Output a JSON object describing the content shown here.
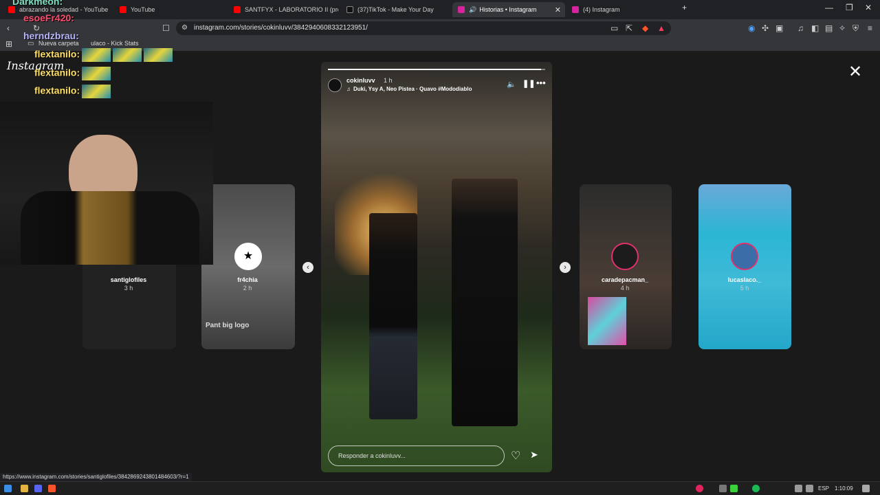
{
  "browser": {
    "tabs": [
      {
        "label": "abrazando la soledad - YouTube",
        "color": "#ff0000"
      },
      {
        "label": "YouTube",
        "color": "#ff0000"
      },
      {
        "label": "SANTFYX - LABORATORIO II (prod.qu",
        "color": "#ff0000"
      },
      {
        "label": "(37)TikTok - Make Your Day",
        "color": "#111111"
      },
      {
        "label": "Historias • Instagram",
        "color": "#d6249f"
      },
      {
        "label": "(4) Instagram",
        "color": "#d6249f"
      }
    ],
    "url": "instagram.com/stories/cokinluvv/3842940608332123951/",
    "bookmarks": [
      "Nueva carpeta",
      "ulaco - Kick Stats"
    ],
    "status_url": "https://www.instagram.com/stories/santiglofiles/3842869243801484603/?r=1"
  },
  "overlay": {
    "chat": [
      {
        "user": "Darkmeon:",
        "color": "#7ee0c0"
      },
      {
        "user": "esoeFr420:",
        "color": "#ff4b6e"
      },
      {
        "user": "herndzbrau:",
        "color": "#b7b7ff"
      },
      {
        "user": "flextanilo:",
        "color": "#ffe066"
      },
      {
        "user": "flextanilo:",
        "color": "#ffe066"
      },
      {
        "user": "flextanilo:",
        "color": "#ffe066"
      }
    ]
  },
  "app": {
    "logo": "Instagram",
    "close_icon": "close-icon"
  },
  "stories_left": [
    {
      "username": "santiglofiles",
      "time": "3 h"
    },
    {
      "username": "fr4chia",
      "time": "2 h",
      "overlay_text": "Pant big logo"
    }
  ],
  "stories_right": [
    {
      "username": "caradepacman_",
      "time": "4 h"
    },
    {
      "username": "lucaslaco._",
      "time": "5 h"
    }
  ],
  "story": {
    "username": "cokinluvv",
    "time": "1 h",
    "music": "Duki, Ysy A, Neo Pistea · Quavo #Mododiablo",
    "progress": 0.98,
    "reply_placeholder": "Responder a cokinluvv..."
  },
  "taskbar": {
    "language": "ESP",
    "clock": "1:10:09"
  }
}
